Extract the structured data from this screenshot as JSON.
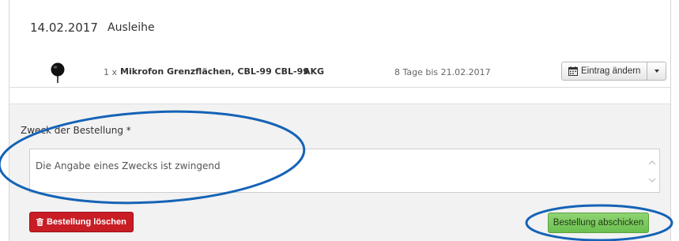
{
  "header": {
    "date": "14.02.2017",
    "title": "Ausleihe"
  },
  "item": {
    "quantity": "1 x",
    "name": "Mikrofon Grenzflächen, CBL-99 CBL-99",
    "brand": "AKG",
    "duration": "8 Tage bis 21.02.2017",
    "edit_label": "Eintrag ändern"
  },
  "form": {
    "purpose_label": "Zweck der Bestellung *",
    "purpose_text": "Die Angabe eines Zwecks ist zwingend"
  },
  "actions": {
    "delete_label": "Bestellung löschen",
    "submit_label": "Bestellung abschicken"
  },
  "colors": {
    "delete": "#c81d25",
    "submit": "#7ccb5f",
    "annotation": "#1563b6"
  }
}
